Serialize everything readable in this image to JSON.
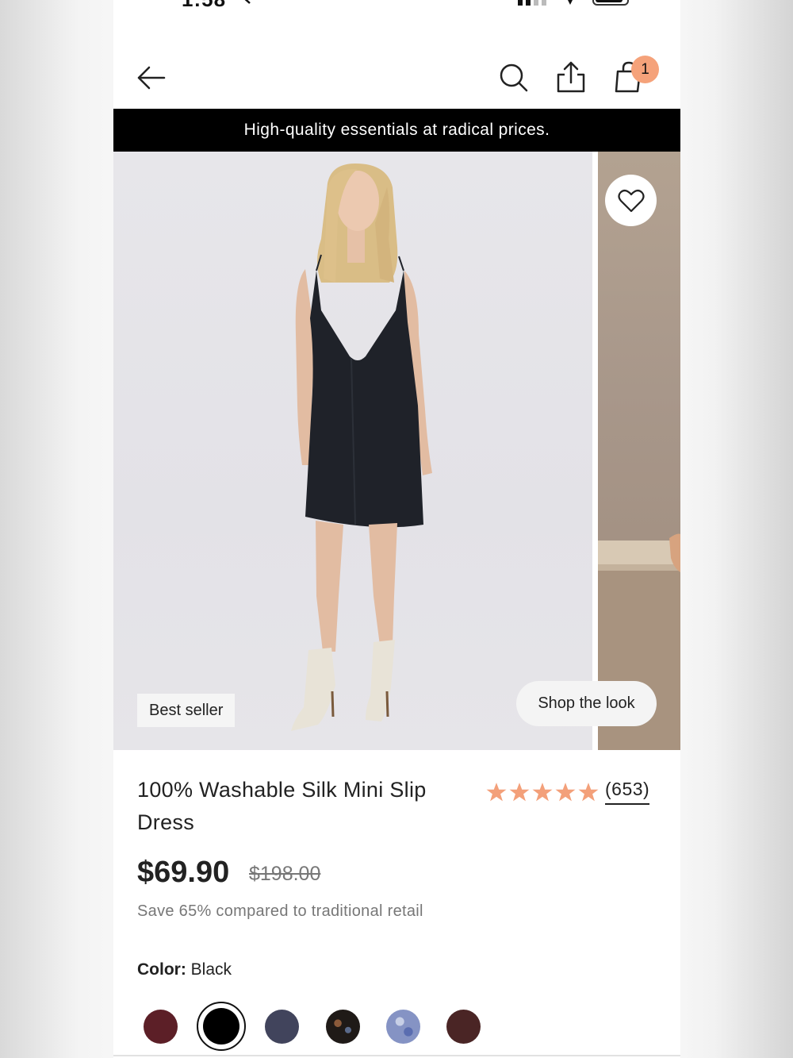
{
  "status_bar": {
    "time": "1:58"
  },
  "nav": {
    "back_icon": "arrow-left-icon",
    "search_icon": "search-icon",
    "share_icon": "share-icon",
    "cart_icon": "shopping-bag-icon",
    "cart_count": "1"
  },
  "promo": {
    "text": "High-quality essentials at radical prices."
  },
  "gallery": {
    "best_seller_badge": "Best seller",
    "shop_the_look": "Shop the look",
    "favorite_icon": "heart-icon"
  },
  "product": {
    "title": "100% Washable Silk Mini Slip Dress",
    "rating_stars": 5,
    "review_count": "(653)",
    "price": "$69.90",
    "original_price": "$198.00",
    "savings_text": "Save 65% compared to traditional retail",
    "color_label": "Color:",
    "color_value": "Black",
    "swatches": [
      {
        "name": "burgundy",
        "color": "#5c1f27",
        "selected": false
      },
      {
        "name": "black",
        "color": "#000000",
        "selected": true
      },
      {
        "name": "navy",
        "color": "#41445c",
        "selected": false
      },
      {
        "name": "dark-floral",
        "color": "#2b231f",
        "selected": false
      },
      {
        "name": "blue-floral",
        "color": "#8593c4",
        "selected": false
      },
      {
        "name": "chocolate",
        "color": "#4a2525",
        "selected": false
      }
    ]
  },
  "colors": {
    "accent": "#f5a27a",
    "star": "#f3a07a",
    "promo_bg": "#000000"
  }
}
